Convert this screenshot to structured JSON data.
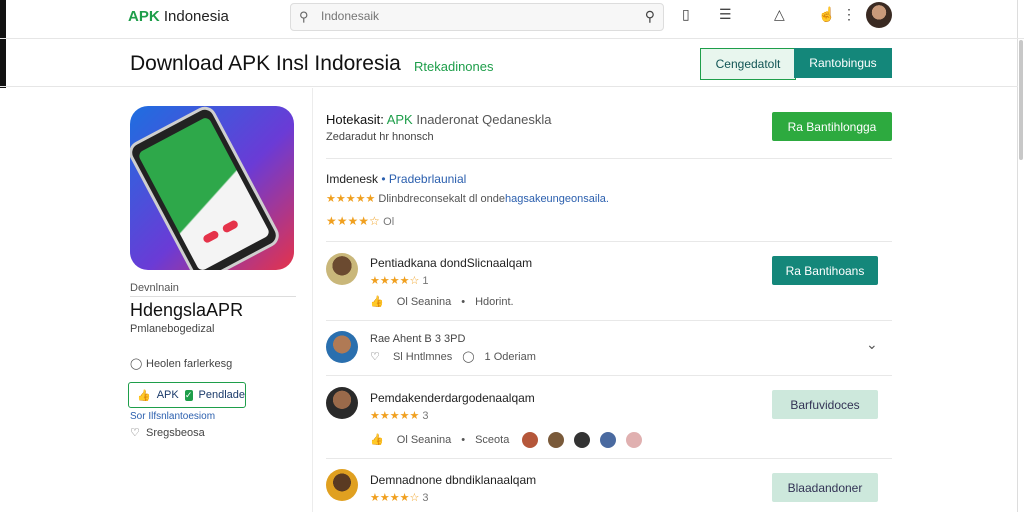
{
  "topbar": {
    "logo_a": "APK",
    "logo_b": " Indonesia",
    "search_placeholder": "Indonesaik",
    "icons": [
      "search-icon",
      "bookmark-icon",
      "list-icon",
      "bell-icon",
      "thumb-icon",
      "more-icon"
    ]
  },
  "header": {
    "title": "Download APK Insl Indoresia",
    "subtitle": "Rtekadinones",
    "btn_outline": "Cengedatolt",
    "btn_primary": "Rantobingus"
  },
  "left": {
    "download_label": "Devnlnain",
    "app_name": "HdengslaAPR",
    "app_sub": "Pmlanebogedizal",
    "row1": "Heolen farlerkesg",
    "verify_label": "APK",
    "verify_text": "Pendlade",
    "verify_link": "Sor Ilfsnlantoesiom",
    "row2": "Sregsbeosa"
  },
  "info": {
    "title_a": "Hotekasit:",
    "title_b": " APK",
    "title_c": " Inaderonat Qedaneskla",
    "sub": "Zedaradut hr hnonsch",
    "download_btn": "Ra Bantihlongga"
  },
  "reviews_header": {
    "label": "Imdenesk",
    "sep": " • ",
    "link": "Pradebrlaunial",
    "stars1": "★★★★★",
    "text1": "Dlinbdreconsekalt dl onde",
    "text1b": "hagsakeungeonsaila.",
    "stars2": "★★★★☆",
    "text2": "Ol"
  },
  "reviews": [
    {
      "name": "Pentiadkana dondSlicnaalqam",
      "stars": "★★★★☆",
      "score": "1",
      "meta_a": "Ol Seanina",
      "meta_b": "Hdorint.",
      "button": "Ra Bantihoans"
    },
    {
      "name": "Rae Ahent B 3 3PD",
      "stars": "",
      "score": "",
      "meta_a": "Sl Hntlmnes",
      "meta_b": "1 Oderiam",
      "button": ""
    },
    {
      "name": "Pemdakenderdargodenaalqam",
      "stars": "★★★★★",
      "score": "3",
      "meta_a": "Ol Seanina",
      "meta_b": "Sceota",
      "button": "Barfuvidoces"
    },
    {
      "name": "Demnadnone dbndiklanaalqam",
      "stars": "★★★★☆",
      "score": "3",
      "meta_a": "",
      "meta_b": "",
      "button": "Blaadandoner"
    }
  ],
  "colors": {
    "brand": "#1e9e4a",
    "teal": "#14877a",
    "star": "#f0a020",
    "link": "#2b5fae"
  }
}
